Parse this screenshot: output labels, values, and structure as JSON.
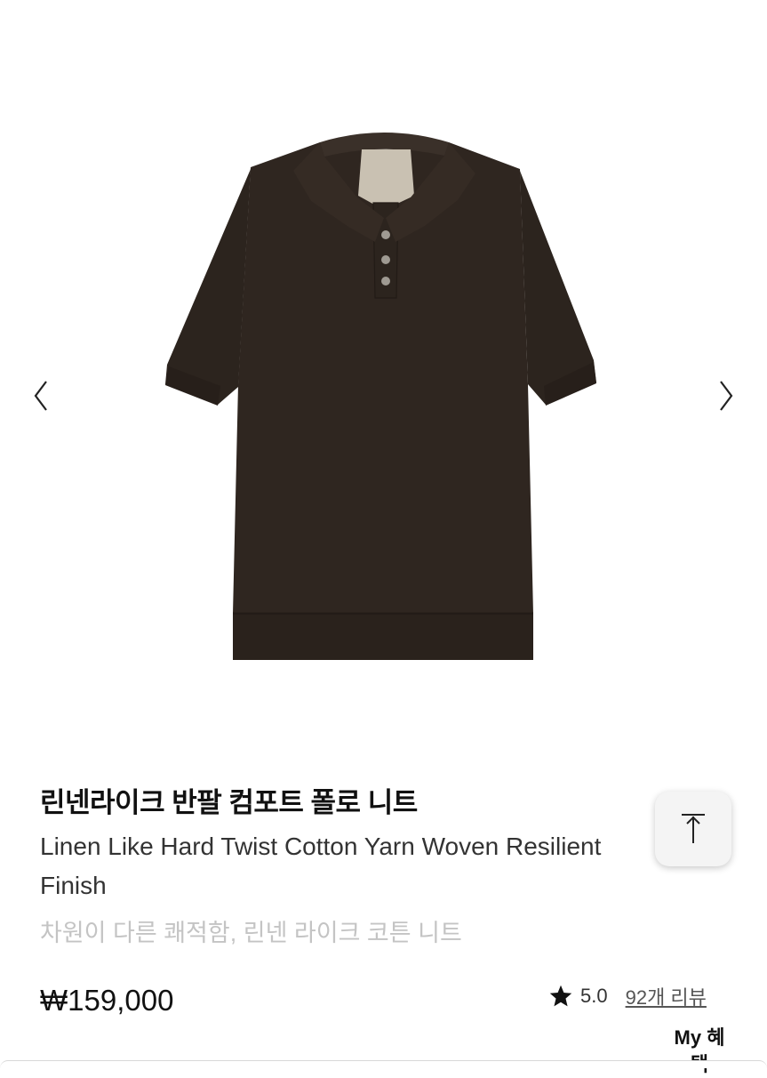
{
  "gallery": {
    "prev_icon": "chevron-left-icon",
    "next_icon": "chevron-right-icon",
    "image_subject": "dark brown short sleeve knit polo shirt"
  },
  "product": {
    "title_ko": "린넨라이크 반팔 컴포트 폴로 니트",
    "title_en": "Linen Like Hard Twist Cotton Yarn Woven Resilient Finish",
    "subtitle": "차원이 다른 쾌적함, 린넨 라이크 코튼 니트",
    "price": "₩159,000",
    "rating": "5.0",
    "reviews": "92개 리뷰"
  },
  "floating": {
    "top_icon": "arrow-to-top-icon",
    "my_benefit": "My 혜택"
  },
  "colors": {
    "shirt": "#2f2620",
    "subtitle": "#c4c4c4",
    "text": "#111111"
  }
}
